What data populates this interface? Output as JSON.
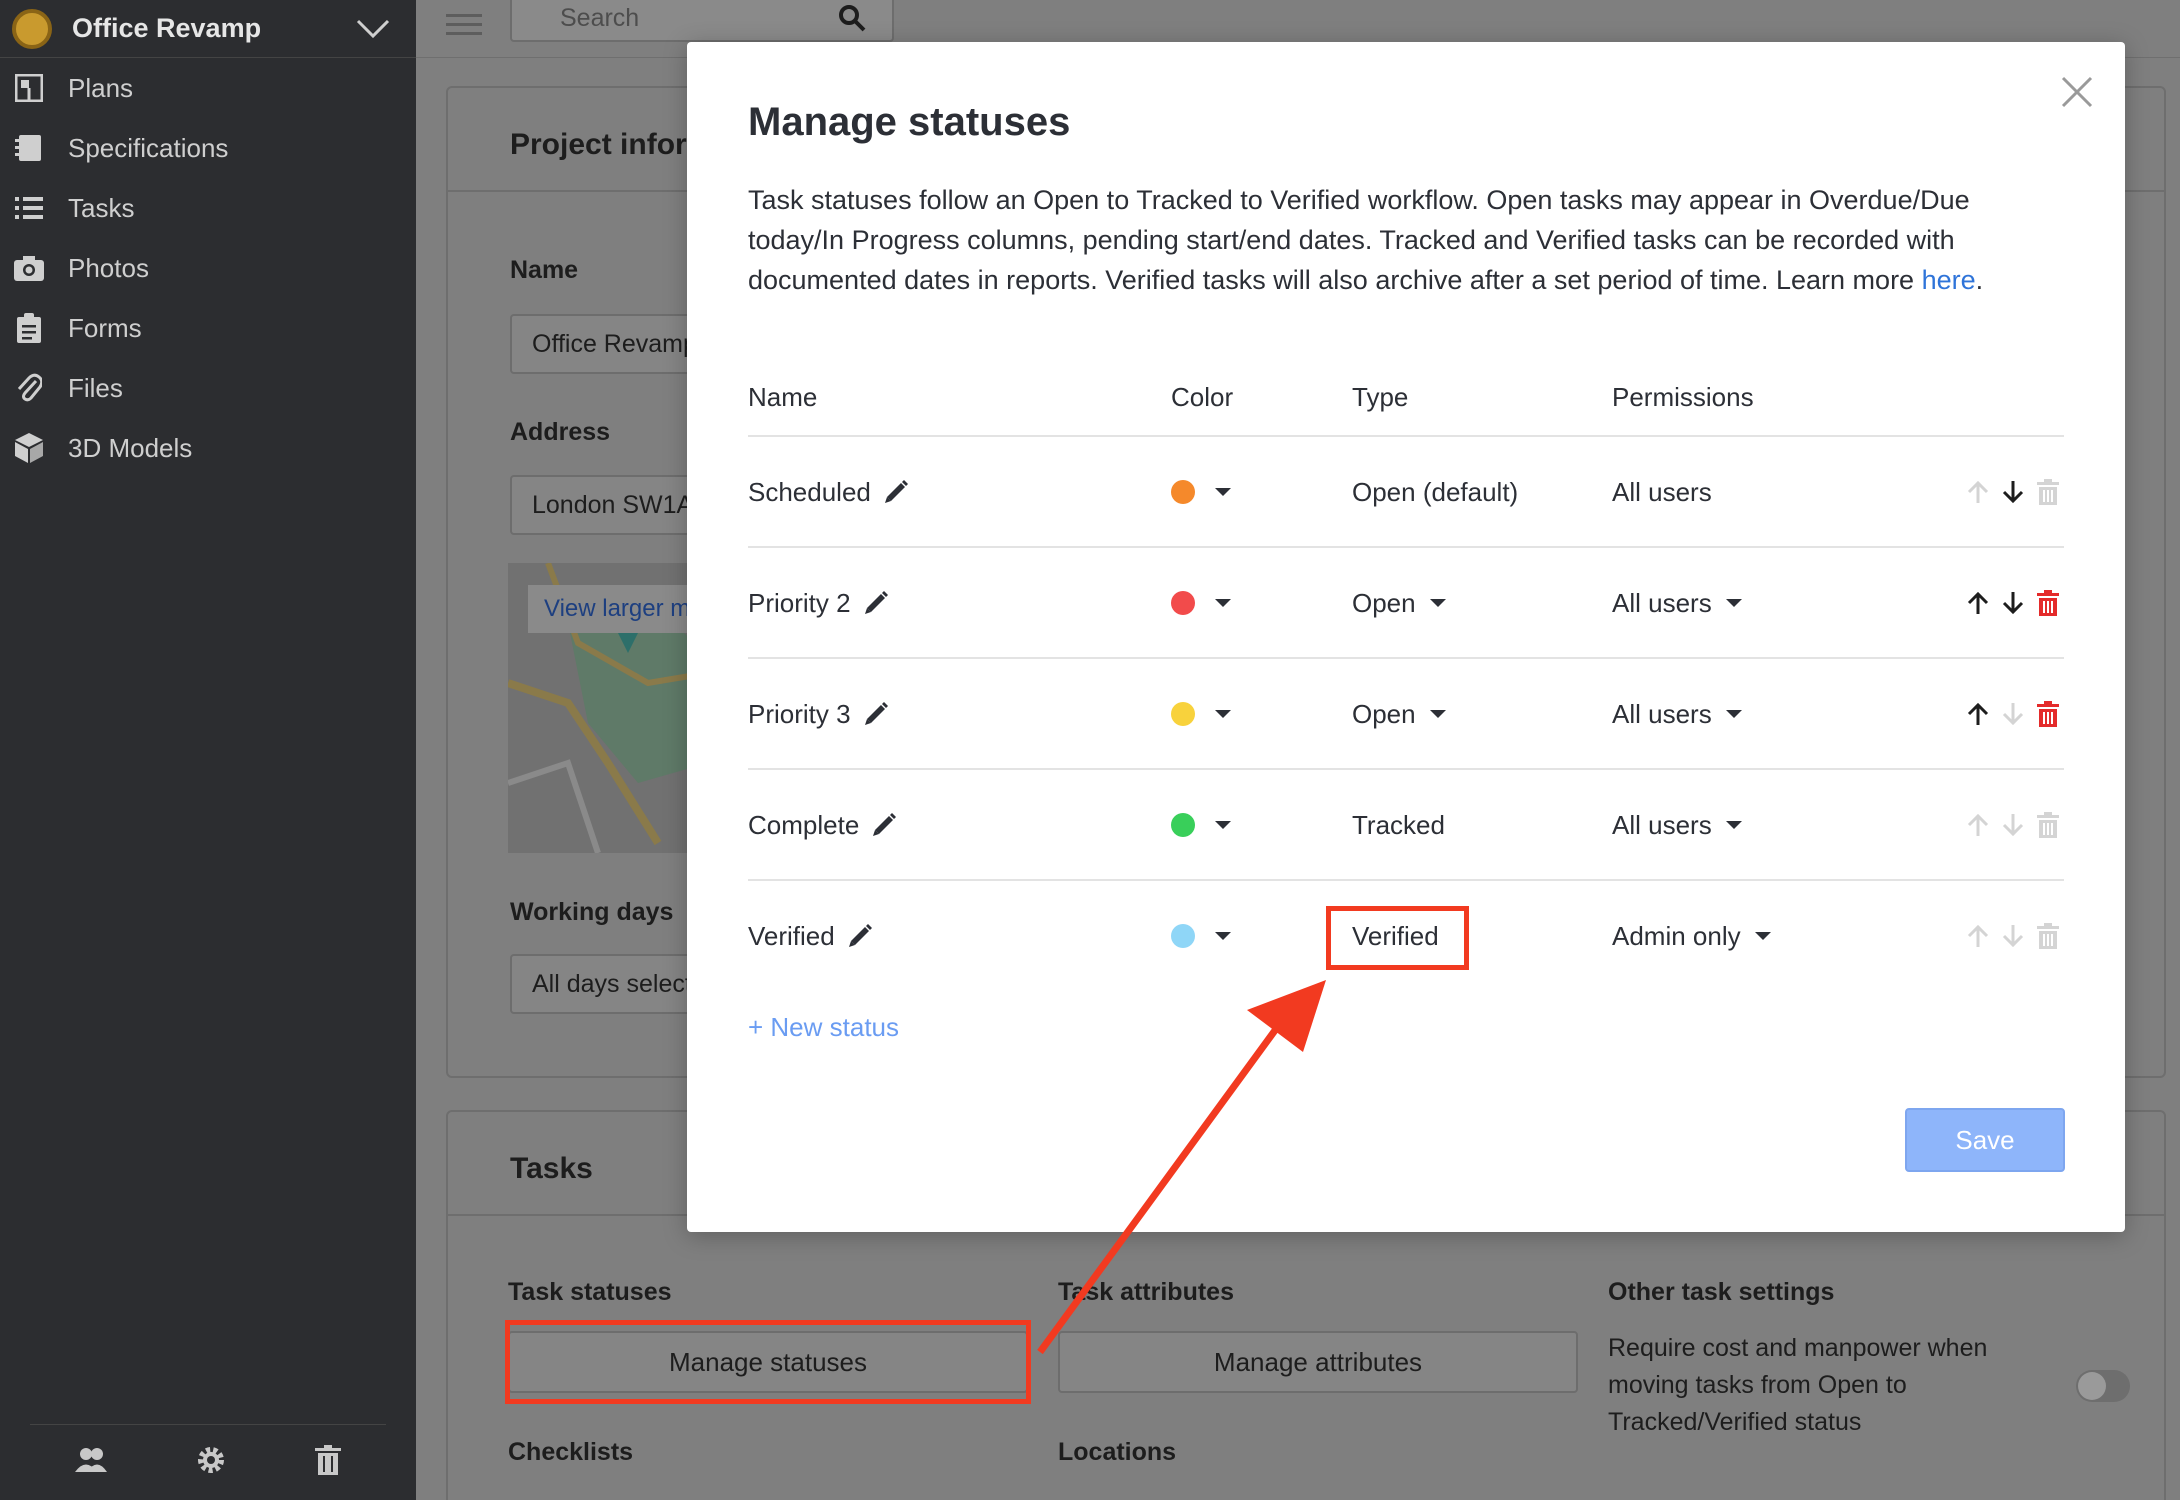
{
  "sidebar": {
    "project_name": "Office Revamp",
    "items": [
      {
        "label": "Plans",
        "icon": "plans-icon"
      },
      {
        "label": "Specifications",
        "icon": "specifications-icon"
      },
      {
        "label": "Tasks",
        "icon": "tasks-icon"
      },
      {
        "label": "Photos",
        "icon": "camera-icon"
      },
      {
        "label": "Forms",
        "icon": "forms-icon"
      },
      {
        "label": "Files",
        "icon": "paperclip-icon"
      },
      {
        "label": "3D Models",
        "icon": "cube-icon"
      }
    ],
    "footer_icons": [
      "people-icon",
      "gear-icon",
      "trash-icon"
    ]
  },
  "topbar": {
    "search_placeholder": "Search"
  },
  "project_info": {
    "title": "Project inform",
    "name_label": "Name",
    "name_value": "Office Revamp",
    "address_label": "Address",
    "address_value": "London SW1A",
    "map_link": "View larger m",
    "working_days_label": "Working days",
    "working_days_value": "All days select"
  },
  "tasks_section": {
    "title": "Tasks",
    "task_statuses_label": "Task statuses",
    "manage_statuses_button": "Manage statuses",
    "task_attributes_label": "Task attributes",
    "manage_attributes_button": "Manage attributes",
    "other_settings_label": "Other task settings",
    "other_settings_text": "Require cost and manpower when moving tasks from Open to Tracked/Verified status",
    "checklists_label": "Checklists",
    "locations_label": "Locations"
  },
  "modal": {
    "title": "Manage statuses",
    "description": "Task statuses follow an Open to Tracked to Verified workflow. Open tasks may appear in Overdue/Due today/In Progress columns, pending start/end dates. Tracked and Verified tasks can be recorded with documented dates in reports. Verified tasks will also archive after a set period of time. Learn more ",
    "description_link": "here",
    "description_end": ".",
    "columns": {
      "name": "Name",
      "color": "Color",
      "type": "Type",
      "permissions": "Permissions"
    },
    "statuses": [
      {
        "name": "Scheduled",
        "color": "#f5892b",
        "type": "Open (default)",
        "type_dropdown": false,
        "permissions": "All users",
        "permissions_dropdown": false,
        "up": false,
        "down": true,
        "delete": false
      },
      {
        "name": "Priority 2",
        "color": "#f24b4b",
        "type": "Open",
        "type_dropdown": true,
        "permissions": "All users",
        "permissions_dropdown": true,
        "up": true,
        "down": true,
        "delete": true
      },
      {
        "name": "Priority 3",
        "color": "#f8d23c",
        "type": "Open",
        "type_dropdown": true,
        "permissions": "All users",
        "permissions_dropdown": true,
        "up": true,
        "down": false,
        "delete": true
      },
      {
        "name": "Complete",
        "color": "#39cf5a",
        "type": "Tracked",
        "type_dropdown": false,
        "permissions": "All users",
        "permissions_dropdown": true,
        "up": false,
        "down": false,
        "delete": false
      },
      {
        "name": "Verified",
        "color": "#8fd6f7",
        "type": "Verified",
        "type_dropdown": false,
        "permissions": "Admin only",
        "permissions_dropdown": true,
        "up": false,
        "down": false,
        "delete": false
      }
    ],
    "new_status_link": "+ New status",
    "save_button": "Save"
  },
  "colors": {
    "sidebar_bg": "#2c2d30",
    "accent_blue": "#2f74d9",
    "save_blue": "#8eb5fa",
    "annotation_red": "#f23a20",
    "delete_red": "#e42b2b"
  }
}
